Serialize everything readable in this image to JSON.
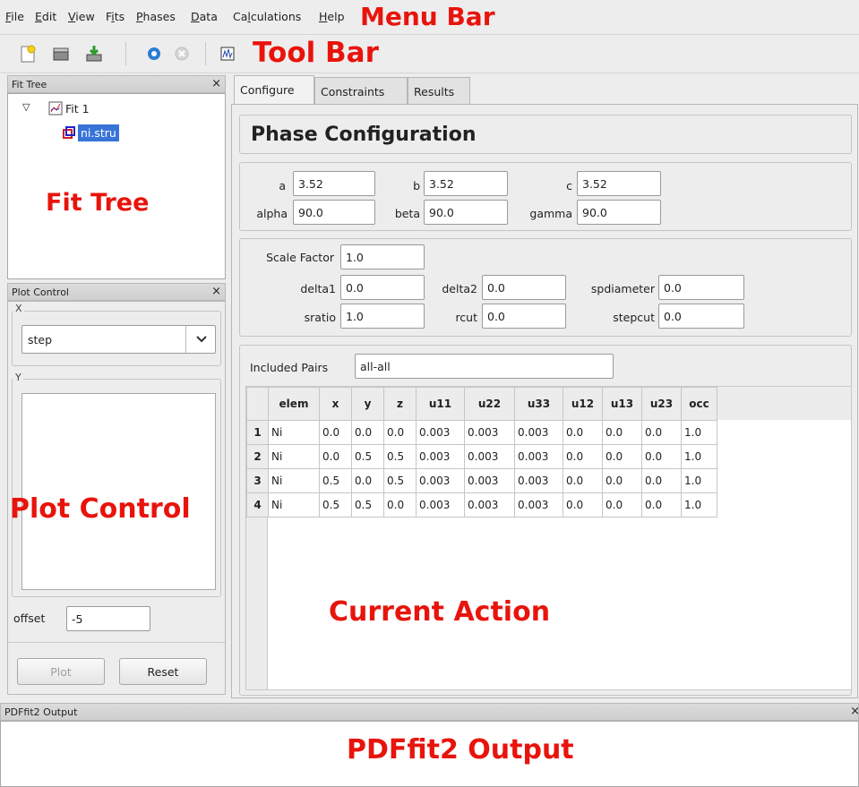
{
  "menu": {
    "items": [
      {
        "label": "File",
        "accel": "F",
        "rest": "ile"
      },
      {
        "label": "Edit",
        "accel": "E",
        "rest": "dit"
      },
      {
        "label": "View",
        "accel": "V",
        "rest": "iew"
      },
      {
        "label": "Fits",
        "pre": "F",
        "accel": "i",
        "rest": "ts"
      },
      {
        "label": "Phases",
        "accel": "P",
        "rest": "hases"
      },
      {
        "label": "Data",
        "accel": "D",
        "rest": "ata"
      },
      {
        "label": "Calculations",
        "pre": "Ca",
        "accel": "l",
        "rest": "culations"
      },
      {
        "label": "Help",
        "accel": "H",
        "rest": "elp"
      }
    ],
    "annotation": "Menu Bar"
  },
  "toolbar": {
    "annotation": "Tool Bar",
    "icons": [
      "new-project-icon",
      "open-project-icon",
      "save-project-icon",
      "run-fit-icon",
      "stop-fit-icon",
      "plot-icon"
    ]
  },
  "fit_tree": {
    "title": "Fit Tree",
    "close": "×",
    "fit_label": "Fit 1",
    "phase_label": "ni.stru",
    "annotation": "Fit Tree"
  },
  "plot_control": {
    "title": "Plot Control",
    "close": "×",
    "x_group": "X",
    "x_value": "step",
    "y_group": "Y",
    "offset_label": "offset",
    "offset_value": "-5",
    "plot_button": "Plot",
    "reset_button": "Reset",
    "annotation": "Plot Control"
  },
  "tabs": [
    "Configure",
    "Constraints",
    "Results"
  ],
  "phase": {
    "heading": "Phase Configuration",
    "lattice": {
      "a_label": "a",
      "a": "3.52",
      "b_label": "b",
      "b": "3.52",
      "c_label": "c",
      "c": "3.52",
      "alpha_label": "alpha",
      "alpha": "90.0",
      "beta_label": "beta",
      "beta": "90.0",
      "gamma_label": "gamma",
      "gamma": "90.0"
    },
    "params": {
      "scale_label": "Scale Factor",
      "scale": "1.0",
      "delta1_label": "delta1",
      "delta1": "0.0",
      "delta2_label": "delta2",
      "delta2": "0.0",
      "spdiameter_label": "spdiameter",
      "spdiameter": "0.0",
      "sratio_label": "sratio",
      "sratio": "1.0",
      "rcut_label": "rcut",
      "rcut": "0.0",
      "stepcut_label": "stepcut",
      "stepcut": "0.0"
    },
    "pairs_label": "Included Pairs",
    "pairs_value": "all-all",
    "table": {
      "columns": [
        "elem",
        "x",
        "y",
        "z",
        "u11",
        "u22",
        "u33",
        "u12",
        "u13",
        "u23",
        "occ"
      ],
      "rows": [
        [
          "1",
          "Ni",
          "0.0",
          "0.0",
          "0.0",
          "0.003",
          "0.003",
          "0.003",
          "0.0",
          "0.0",
          "0.0",
          "1.0"
        ],
        [
          "2",
          "Ni",
          "0.0",
          "0.5",
          "0.5",
          "0.003",
          "0.003",
          "0.003",
          "0.0",
          "0.0",
          "0.0",
          "1.0"
        ],
        [
          "3",
          "Ni",
          "0.5",
          "0.0",
          "0.5",
          "0.003",
          "0.003",
          "0.003",
          "0.0",
          "0.0",
          "0.0",
          "1.0"
        ],
        [
          "4",
          "Ni",
          "0.5",
          "0.5",
          "0.0",
          "0.003",
          "0.003",
          "0.003",
          "0.0",
          "0.0",
          "0.0",
          "1.0"
        ]
      ]
    },
    "annotation": "Current Action"
  },
  "output": {
    "title": "PDFfit2 Output",
    "close": "×",
    "annotation": "PDFfit2 Output"
  }
}
